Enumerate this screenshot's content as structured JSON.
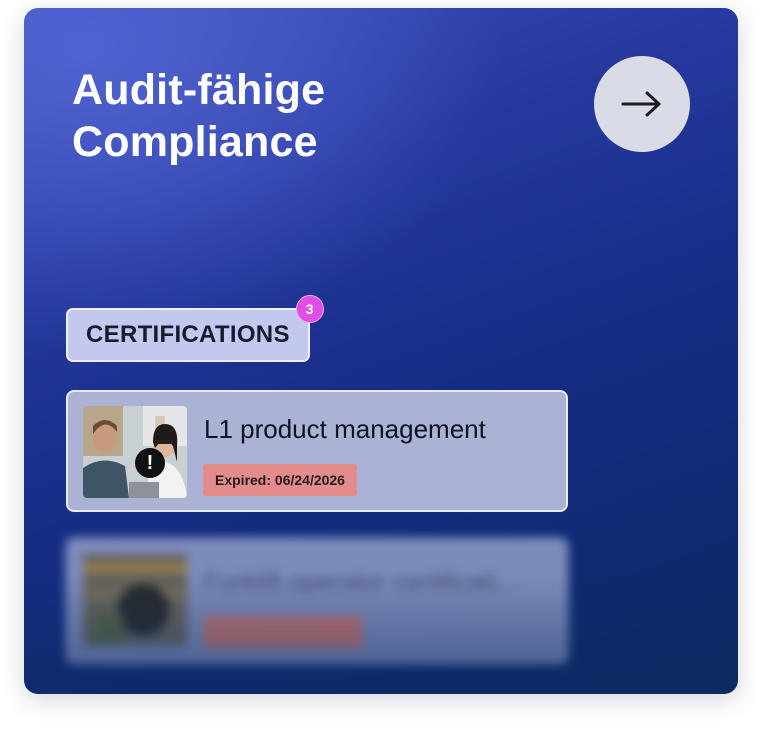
{
  "card": {
    "title_line1": "Audit-fähige",
    "title_line2": "Compliance",
    "arrow_icon": "arrow-right-icon"
  },
  "certifications": {
    "label": "CERTIFICATIONS",
    "count": "3",
    "items": [
      {
        "name": "L1 product management",
        "status": "Expired: 06/24/2026",
        "status_color": "#e38c8b",
        "alert_icon": "exclamation-icon"
      },
      {
        "name": "Forklift operator certificati...",
        "status": "",
        "status_color": "#d17c6f"
      }
    ]
  },
  "colors": {
    "accent_badge": "#e04ee6",
    "card_gradient_top": "#3c4fb8",
    "card_gradient_bottom": "#0c2b62"
  }
}
